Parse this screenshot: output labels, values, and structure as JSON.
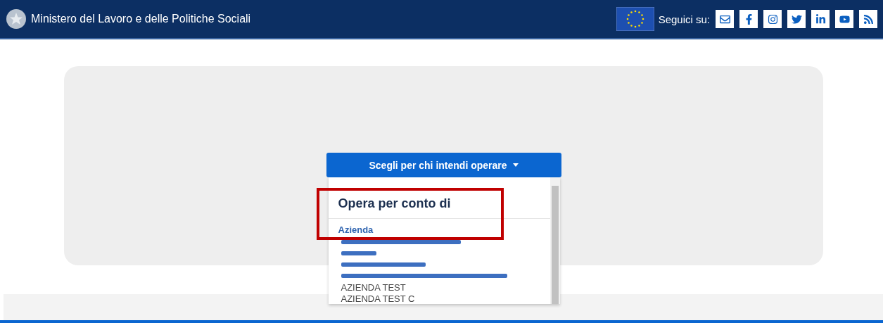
{
  "header": {
    "title": "Ministero del Lavoro e delle Politiche Sociali",
    "follow_label": "Seguici su:",
    "social": [
      {
        "kind": "mail"
      },
      {
        "kind": "facebook"
      },
      {
        "kind": "instagram"
      },
      {
        "kind": "twitter"
      },
      {
        "kind": "linkedin"
      },
      {
        "kind": "youtube"
      },
      {
        "kind": "rss"
      }
    ]
  },
  "dropdown": {
    "button": "Scegli per chi intendi operare",
    "expanded": true,
    "heading": "Opera per conto di",
    "group": "Azienda",
    "highlighted": true,
    "items": [
      {
        "kind": "redacted"
      },
      {
        "kind": "redacted"
      },
      {
        "kind": "redacted"
      },
      {
        "kind": "redacted"
      },
      {
        "kind": "entry",
        "label": "AZIENDA TEST"
      },
      {
        "kind": "entry",
        "label": "AZIENDA TEST C"
      }
    ]
  }
}
